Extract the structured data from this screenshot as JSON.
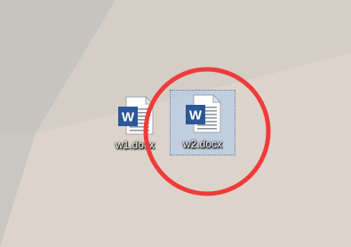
{
  "desktop": {
    "icons": [
      {
        "label": "w1.docx",
        "icon": "word-document-icon",
        "selected": false
      },
      {
        "label": "w2.docx",
        "icon": "word-document-icon",
        "selected": true
      }
    ]
  },
  "colors": {
    "word_blue": "#2b5797",
    "annotation_red": "#ef3b3b",
    "selection_fill": "#b9d3f3"
  }
}
